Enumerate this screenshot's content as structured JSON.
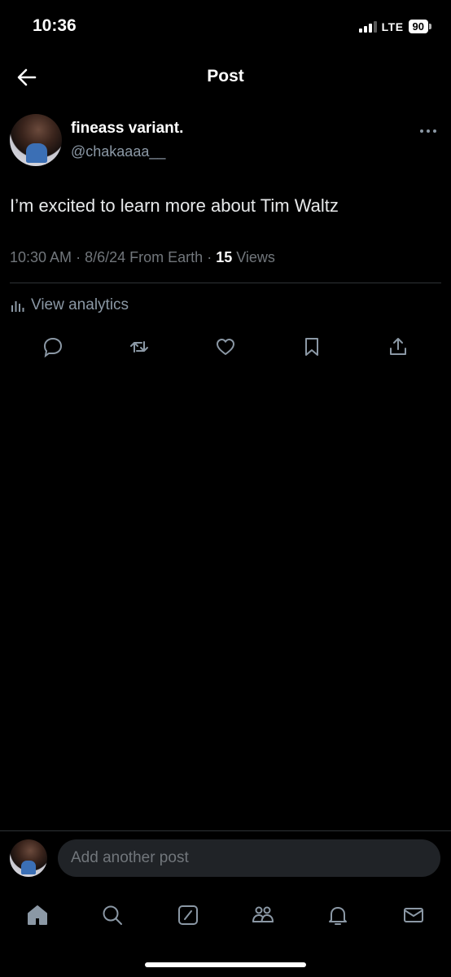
{
  "status_bar": {
    "time": "10:36",
    "network": "LTE",
    "battery": "90"
  },
  "header": {
    "title": "Post"
  },
  "post": {
    "author_name": "fineass variant.",
    "author_handle": "@chakaaaa__",
    "text": "I’m excited to learn more about Tim Waltz",
    "time": "10:30 AM",
    "date": "8/6/24",
    "location": "From Earth",
    "views_count": "15",
    "views_label": "Views"
  },
  "analytics": {
    "label": "View analytics"
  },
  "actions": [
    "reply-icon",
    "repost-icon",
    "like-icon",
    "bookmark-icon",
    "share-icon"
  ],
  "compose": {
    "placeholder": "Add another post"
  },
  "tabbar": [
    "home-icon",
    "search-icon",
    "grok-icon",
    "communities-icon",
    "notifications-icon",
    "messages-icon"
  ],
  "colors": {
    "background": "#000000",
    "text": "#e7e9ea",
    "muted": "#8b98a5",
    "input_bg": "#202327"
  }
}
